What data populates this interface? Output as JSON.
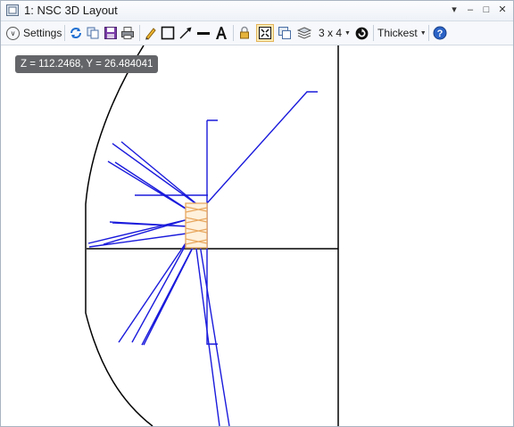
{
  "window": {
    "title": "1: NSC 3D Layout",
    "controls": {
      "menu": "▾",
      "minimize": "‒",
      "maximize": "□",
      "close": "✕"
    }
  },
  "toolbar": {
    "settings_label": "Settings",
    "layout_label": "3 x 4",
    "line_thickness_label": "Thickest"
  },
  "viewport": {
    "cursor_readout": "Z = 112.2468, Y = 26.484041"
  },
  "colors": {
    "ray": "#1a1adc",
    "lens_element": "#e8a860",
    "axis": "#000000",
    "active_tool_bg": "#fde9b6"
  },
  "icons": [
    "layout-window-icon",
    "settings-chevron-icon",
    "refresh-icon",
    "copy-icon",
    "save-icon",
    "print-icon",
    "pencil-icon",
    "rectangle-icon",
    "arrow-icon",
    "line-icon",
    "text-icon",
    "lock-icon",
    "zoom-fit-icon",
    "clone-icon",
    "layers-icon",
    "rotate-icon",
    "help-icon"
  ]
}
